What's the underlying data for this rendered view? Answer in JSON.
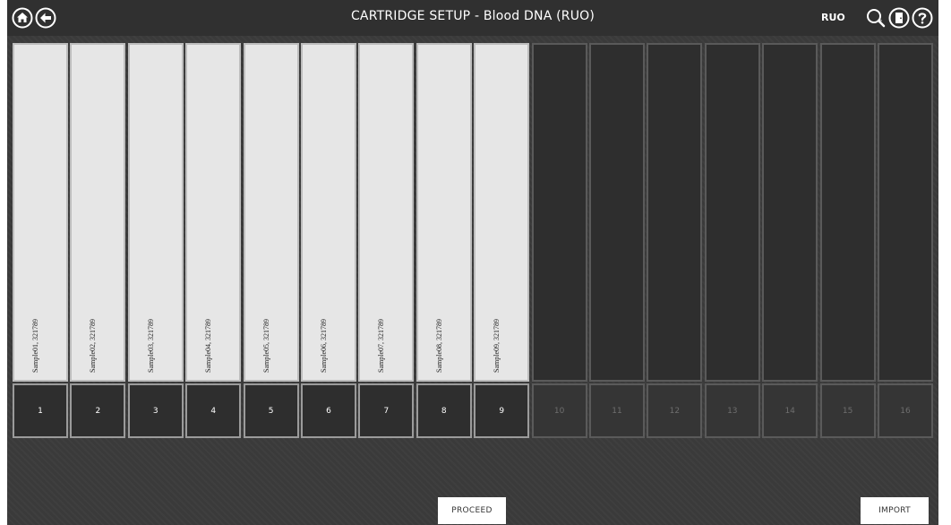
{
  "header": {
    "title": "CARTRIDGE SETUP - Blood DNA (RUO)",
    "mode_badge": "RUO",
    "icons": [
      "home-icon",
      "back-icon",
      "search-icon",
      "exit-icon",
      "help-icon"
    ]
  },
  "slots": [
    {
      "number": "1",
      "label": "Sample01, 321789",
      "filled": true
    },
    {
      "number": "2",
      "label": "Sample02, 321789",
      "filled": true
    },
    {
      "number": "3",
      "label": "Sample03, 321789",
      "filled": true
    },
    {
      "number": "4",
      "label": "Sample04, 321789",
      "filled": true
    },
    {
      "number": "5",
      "label": "Sample05, 321789",
      "filled": true
    },
    {
      "number": "6",
      "label": "Sample06, 321789",
      "filled": true
    },
    {
      "number": "7",
      "label": "Sample07, 321789",
      "filled": true
    },
    {
      "number": "8",
      "label": "Sample08, 321789",
      "filled": true
    },
    {
      "number": "9",
      "label": "Sample09, 321789",
      "filled": true
    },
    {
      "number": "10",
      "label": "",
      "filled": false
    },
    {
      "number": "11",
      "label": "",
      "filled": false
    },
    {
      "number": "12",
      "label": "",
      "filled": false
    },
    {
      "number": "13",
      "label": "",
      "filled": false
    },
    {
      "number": "14",
      "label": "",
      "filled": false
    },
    {
      "number": "15",
      "label": "",
      "filled": false
    },
    {
      "number": "16",
      "label": "",
      "filled": false
    }
  ],
  "footer": {
    "proceed_label": "PROCEED",
    "import_label": "IMPORT"
  },
  "colors": {
    "background": "#3a3a3a",
    "header": "#303030",
    "filled_slot": "#e6e6e6",
    "empty_slot": "#2e2e2e",
    "button": "#ffffff"
  }
}
